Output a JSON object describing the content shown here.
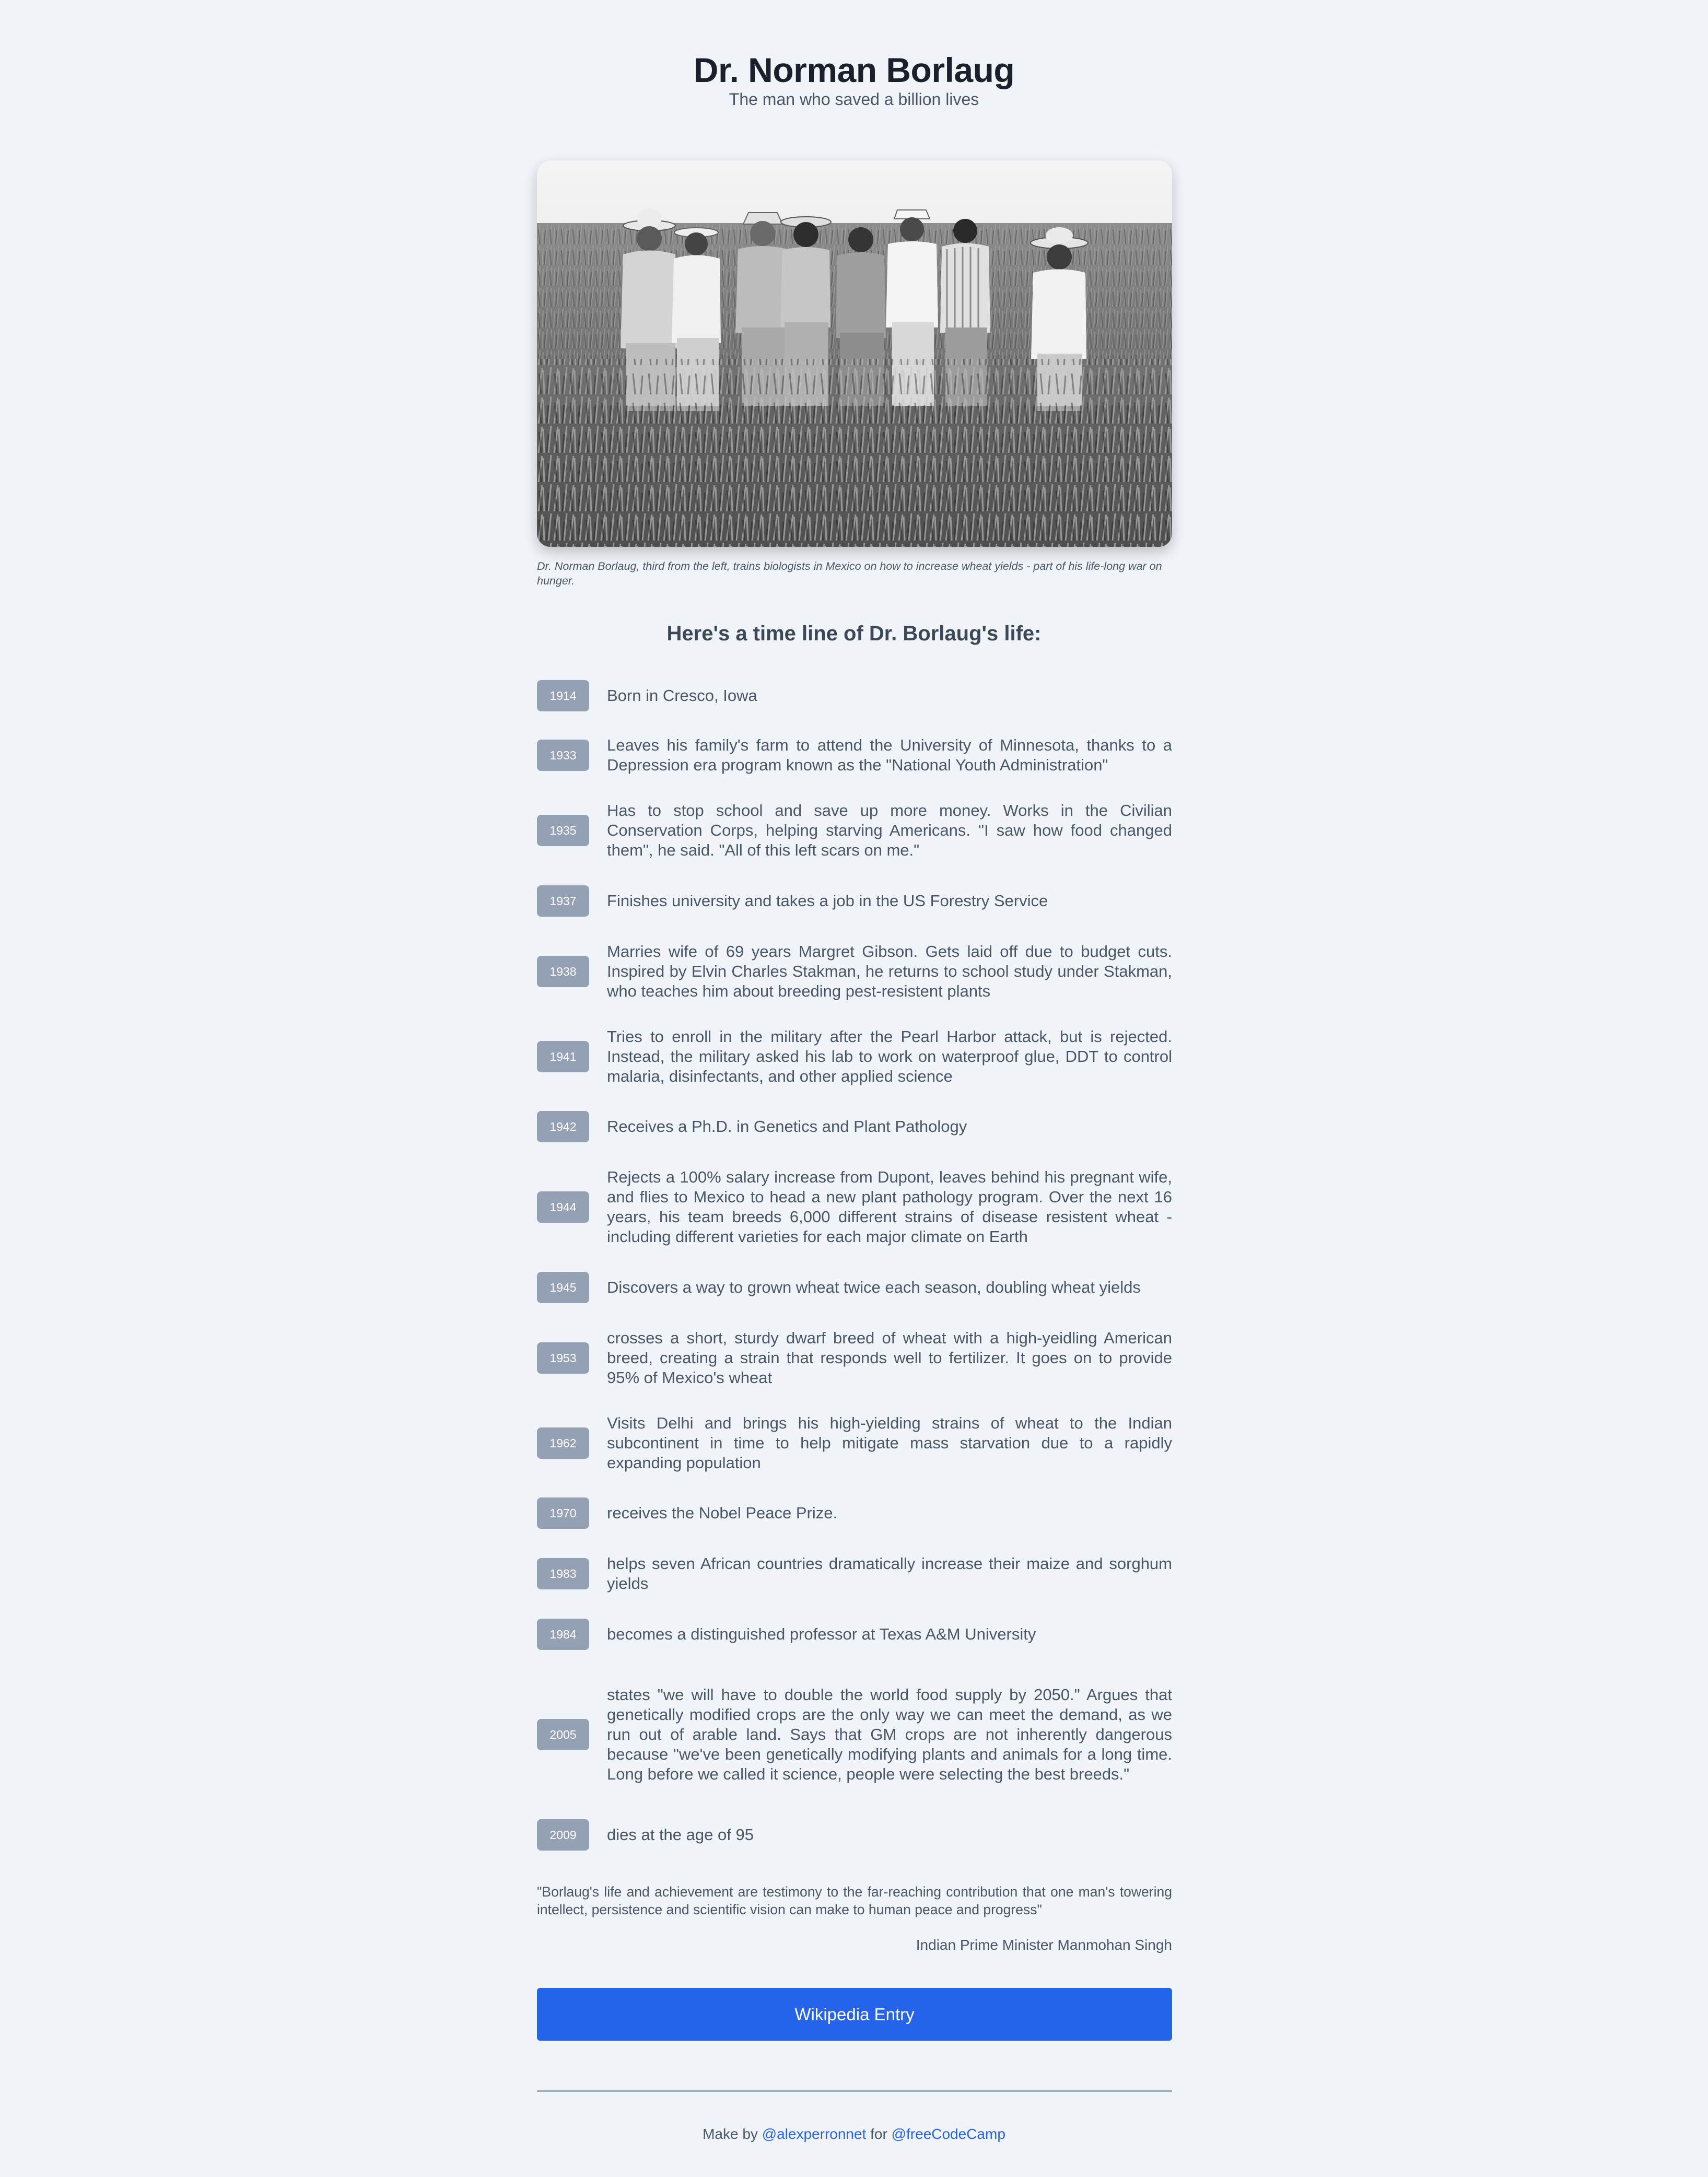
{
  "header": {
    "title": "Dr. Norman Borlaug",
    "subtitle": "The man who saved a billion lives"
  },
  "photo": {
    "caption": "Dr. Norman Borlaug, third from the left, trains biologists in Mexico on how to increase wheat yields - part of his life-long war on hunger."
  },
  "timeline": {
    "heading": "Here's a time line of Dr. Borlaug's life:",
    "events": [
      {
        "year": "1914",
        "text": "Born in Cresco, Iowa"
      },
      {
        "year": "1933",
        "text": "Leaves his family's farm to attend the University of Minnesota, thanks to a Depression era program known as the \"National Youth Administration\""
      },
      {
        "year": "1935",
        "text": "Has to stop school and save up more money. Works in the Civilian Conservation Corps, helping starving Americans. \"I saw how food changed them\", he said. \"All of this left scars on me.\""
      },
      {
        "year": "1937",
        "text": "Finishes university and takes a job in the US Forestry Service"
      },
      {
        "year": "1938",
        "text": "Marries wife of 69 years Margret Gibson. Gets laid off due to budget cuts. Inspired by Elvin Charles Stakman, he returns to school study under Stakman, who teaches him about breeding pest-resistent plants"
      },
      {
        "year": "1941",
        "text": "Tries to enroll in the military after the Pearl Harbor attack, but is rejected. Instead, the military asked his lab to work on waterproof glue, DDT to control malaria, disinfectants, and other applied science"
      },
      {
        "year": "1942",
        "text": "Receives a Ph.D. in Genetics and Plant Pathology"
      },
      {
        "year": "1944",
        "text": "Rejects a 100% salary increase from Dupont, leaves behind his pregnant wife, and flies to Mexico to head a new plant pathology program. Over the next 16 years, his team breeds 6,000 different strains of disease resistent wheat - including different varieties for each major climate on Earth"
      },
      {
        "year": "1945",
        "text": "Discovers a way to grown wheat twice each season, doubling wheat yields"
      },
      {
        "year": "1953",
        "text": "crosses a short, sturdy dwarf breed of wheat with a high-yeidling American breed, creating a strain that responds well to fertilizer. It goes on to provide 95% of Mexico's wheat"
      },
      {
        "year": "1962",
        "text": "Visits Delhi and brings his high-yielding strains of wheat to the Indian subcontinent in time to help mitigate mass starvation due to a rapidly expanding population"
      },
      {
        "year": "1970",
        "text": "receives the Nobel Peace Prize."
      },
      {
        "year": "1983",
        "text": "helps seven African countries dramatically increase their maize and sorghum yields"
      },
      {
        "year": "1984",
        "text": "becomes a distinguished professor at Texas A&M University"
      },
      {
        "year": "2005",
        "text": "states \"we will have to double the world food supply by 2050.\" Argues that genetically modified crops are the only way we can meet the demand, as we run out of arable land. Says that GM crops are not inherently dangerous because \"we've been genetically modifying plants and animals for a long time. Long before we called it science, people were selecting the best breeds.\""
      },
      {
        "year": "2009",
        "text": "dies at the age of 95"
      }
    ]
  },
  "quote": {
    "text": "\"Borlaug's life and achievement are testimony to the far-reaching contribution that one man's towering intellect, persistence and scientific vision can make to human peace and progress\"",
    "author": "Indian Prime Minister Manmohan Singh"
  },
  "wiki_button": {
    "label": "Wikipedia Entry"
  },
  "footer": {
    "prefix": "Make by",
    "author_link": "@alexperronnet",
    "middle": "for",
    "org_link": "@freeCodeCamp"
  }
}
